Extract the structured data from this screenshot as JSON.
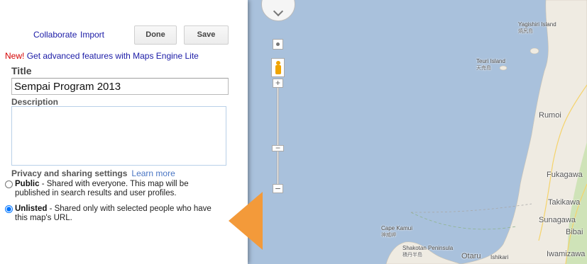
{
  "toolbar": {
    "collaborate_label": "Collaborate",
    "import_label": "Import",
    "done_label": "Done",
    "save_label": "Save"
  },
  "promo": {
    "new_label": "New!",
    "link_text": "Get advanced features with Maps Engine Lite"
  },
  "form": {
    "title_label": "Title",
    "title_value": "Sempai Program 2013",
    "description_label": "Description",
    "description_value": ""
  },
  "privacy": {
    "heading": "Privacy and sharing settings",
    "learn_more": "Learn more",
    "options": [
      {
        "name": "Public",
        "text": " - Shared with everyone. This map will be published in search results and user profiles.",
        "selected": false
      },
      {
        "name": "Unlisted",
        "text": " - Shared only with selected people who have this map's URL.",
        "selected": true
      }
    ]
  },
  "map": {
    "places": [
      {
        "name": "Yagishiri Island",
        "sub": "焼尻島"
      },
      {
        "name": "Teuri Island",
        "sub": "天売島"
      },
      {
        "name": "Rumoi",
        "sub": ""
      },
      {
        "name": "Fukagawa",
        "sub": ""
      },
      {
        "name": "Takikawa",
        "sub": ""
      },
      {
        "name": "Sunagawa",
        "sub": ""
      },
      {
        "name": "Bibai",
        "sub": ""
      },
      {
        "name": "Cape Kamui",
        "sub": "神威岬"
      },
      {
        "name": "Shakotan Peninsula",
        "sub": "積丹半島"
      },
      {
        "name": "Otaru",
        "sub": ""
      },
      {
        "name": "Ishikari",
        "sub": ""
      },
      {
        "name": "Iwamizawa",
        "sub": ""
      }
    ],
    "controls": {
      "zoom_in": "+",
      "zoom_out": "−",
      "zoom_thumb": "−"
    }
  },
  "colors": {
    "water": "#a9c1dc",
    "land": "#efebe2",
    "accent": "#f39a3a",
    "link": "#1a1aa6",
    "new_badge": "#d40000"
  }
}
